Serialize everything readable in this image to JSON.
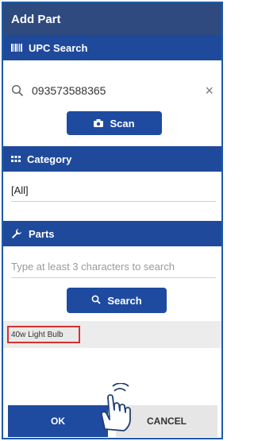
{
  "dialog": {
    "title": "Add Part"
  },
  "upc_section": {
    "title": "UPC Search",
    "icon": "barcode-icon"
  },
  "upc_search": {
    "value": "093573588365",
    "clear_symbol": "×"
  },
  "scan_button": {
    "label": "Scan",
    "icon": "camera-icon"
  },
  "category_section": {
    "title": "Category",
    "icon": "grid-icon"
  },
  "category": {
    "value": "[All]"
  },
  "parts_section": {
    "title": "Parts",
    "icon": "wrench-icon"
  },
  "parts_search": {
    "placeholder": "Type at least 3 characters to search",
    "value": ""
  },
  "search_button": {
    "label": "Search",
    "icon": "search-icon"
  },
  "results": [
    {
      "label": "40w Light Bulb"
    }
  ],
  "footer": {
    "ok_label": "OK",
    "cancel_label": "CANCEL"
  },
  "colors": {
    "header": "#2e4a7e",
    "section": "#1f4a9c",
    "button": "#1e4ba0",
    "highlight": "#d6322b"
  }
}
